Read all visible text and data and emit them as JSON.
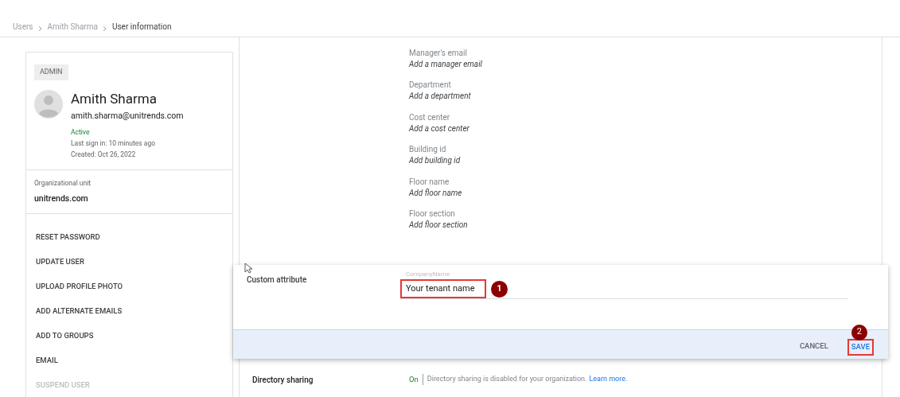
{
  "breadcrumb": [
    {
      "label": "Users",
      "current": false
    },
    {
      "label": "Amith Sharma",
      "current": false
    },
    {
      "label": "User information",
      "current": true
    }
  ],
  "user": {
    "role": "ADMIN",
    "name": "Amith Sharma",
    "email": "amith.sharma@unitrends.com",
    "status": "Active",
    "last_sign_in": "Last sign in: 10 minutes ago",
    "created": "Created: Oct 26, 2022",
    "org_unit_label": "Organizational unit",
    "org_unit": "unitrends.com"
  },
  "actions": [
    {
      "label": "RESET PASSWORD",
      "disabled": false
    },
    {
      "label": "UPDATE USER",
      "disabled": false
    },
    {
      "label": "UPLOAD PROFILE PHOTO",
      "disabled": false
    },
    {
      "label": "ADD ALTERNATE EMAILS",
      "disabled": false
    },
    {
      "label": "ADD TO GROUPS",
      "disabled": false
    },
    {
      "label": "EMAIL",
      "disabled": false
    },
    {
      "label": "SUSPEND USER",
      "disabled": true
    }
  ],
  "fields": [
    {
      "label": "Manager's email",
      "placeholder": "Add a manager email"
    },
    {
      "label": "Department",
      "placeholder": "Add a department"
    },
    {
      "label": "Cost center",
      "placeholder": "Add a cost center"
    },
    {
      "label": "Building id",
      "placeholder": "Add building id"
    },
    {
      "label": "Floor name",
      "placeholder": "Add floor name"
    },
    {
      "label": "Floor section",
      "placeholder": "Add floor section"
    }
  ],
  "dialog": {
    "title": "Custom attribute",
    "field_label": "CompanyName",
    "value": "Your tenant name",
    "step_badges": [
      "1",
      "2"
    ],
    "buttons": [
      {
        "label": "CANCEL",
        "kind": "secondary"
      },
      {
        "label": "SAVE",
        "kind": "primary"
      }
    ]
  },
  "directory_sharing": {
    "label": "Directory sharing",
    "state": "On",
    "text": "Directory sharing is disabled for your organization.",
    "link": "Learn more."
  }
}
